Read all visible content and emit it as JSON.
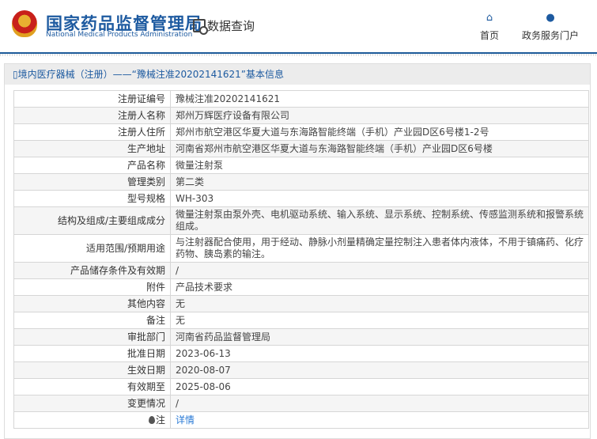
{
  "header": {
    "logo_cn": "国家药品监督管理局",
    "logo_en": "National Medical Products Administration",
    "section": "数据查询",
    "nav": [
      {
        "label": "首页",
        "icon": "home-icon"
      },
      {
        "label": "政务服务门户",
        "icon": "user-icon"
      }
    ]
  },
  "page_title": "境内医疗器械（注册）——“豫械注准20202141621”基本信息",
  "rows": [
    {
      "label": "注册证编号",
      "value": "豫械注准20202141621"
    },
    {
      "label": "注册人名称",
      "value": "郑州万辉医疗设备有限公司"
    },
    {
      "label": "注册人住所",
      "value": "郑州市航空港区华夏大道与东海路智能终端（手机）产业园D区6号楼1-2号"
    },
    {
      "label": "生产地址",
      "value": "河南省郑州市航空港区华夏大道与东海路智能终端（手机）产业园D区6号楼"
    },
    {
      "label": "产品名称",
      "value": "微量注射泵"
    },
    {
      "label": "管理类别",
      "value": "第二类"
    },
    {
      "label": "型号规格",
      "value": "WH-303"
    },
    {
      "label": "结构及组成/主要组成成分",
      "value": "微量注射泵由泵外壳、电机驱动系统、输入系统、显示系统、控制系统、传感监测系统和报警系统组成。"
    },
    {
      "label": "适用范围/预期用途",
      "value": "与注射器配合使用，用于经动、静脉小剂量精确定量控制注入患者体内液体，不用于镇痛药、化疗药物、胰岛素的输注。"
    },
    {
      "label": "产品储存条件及有效期",
      "value": "/"
    },
    {
      "label": "附件",
      "value": "产品技术要求"
    },
    {
      "label": "其他内容",
      "value": "无"
    },
    {
      "label": "备注",
      "value": "无"
    },
    {
      "label": "审批部门",
      "value": "河南省药品监督管理局"
    },
    {
      "label": "批准日期",
      "value": "2023-06-13"
    },
    {
      "label": "生效日期",
      "value": "2020-08-07"
    },
    {
      "label": "有效期至",
      "value": "2025-08-06"
    },
    {
      "label": "变更情况",
      "value": "/"
    }
  ],
  "note": {
    "label": "注",
    "link": "详情"
  }
}
